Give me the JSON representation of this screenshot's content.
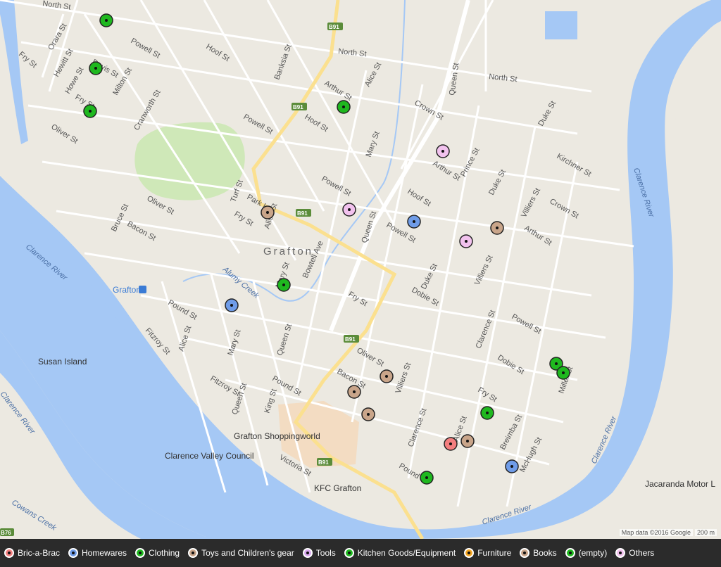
{
  "map": {
    "suburb": "Grafton",
    "attribution": "Map data ©2016 Google",
    "scale": "200 m",
    "colors": {
      "land": "#ece9e1",
      "water": "#a5c8f5",
      "park": "#cfe8b8",
      "road": "#ffffff",
      "highway": "#fbe08f",
      "mall": "#f3dcc2"
    }
  },
  "places": {
    "shopping": "Grafton Shoppingworld",
    "council": "Clarence Valley Council",
    "kfc": "KFC Grafton",
    "station": "Grafton",
    "motor": "Jacaranda Motor L",
    "island": "Susan Island"
  },
  "water_labels": {
    "clarence_1": "Clarence River",
    "clarence_2": "Clarence River",
    "clarence_3": "Clarence River",
    "clarence_4": "Clarence River",
    "clarence_5": "Clarence River",
    "alumy": "Alumy Creek",
    "cowans": "Cowans Creek"
  },
  "streets": {
    "north1": "North St",
    "north2": "North St",
    "north3": "North St",
    "powell1": "Powell St",
    "powell2": "Powell St",
    "powell3": "Powell St",
    "powell4": "Powell St",
    "powell5": "Powell St",
    "hoof1": "Hoof St",
    "hoof2": "Hoof St",
    "hoof3": "Hoof St",
    "oliver1": "Oliver St",
    "oliver2": "Oliver St",
    "oliver3": "Oliver St",
    "arthur1": "Arthur St",
    "arthur2": "Arthur St",
    "arthur3": "Arthur St",
    "fry1": "Fry St",
    "fry2": "Fry St",
    "fry3": "Fry St",
    "fry4": "Fry St",
    "pound1": "Pound St",
    "pound2": "Pound St",
    "pound3": "Pound St",
    "queen1": "Queen St",
    "queen2": "Queen St",
    "queen3": "Queen St",
    "queen4": "Queen St",
    "bacon1": "Bacon St",
    "bacon2": "Bacon St",
    "duke1": "Duke St",
    "duke2": "Duke St",
    "duke3": "Duke St",
    "mary1": "Mary St",
    "mary2": "Mary St",
    "villiers1": "Villiers St",
    "villiers2": "Villiers St",
    "villiers3": "Villiers St",
    "dobie1": "Dobie St",
    "dobie2": "Dobie St",
    "clarence1": "Clarence St",
    "clarence2": "Clarence St",
    "alice1": "Alice St",
    "alice2": "Alice St",
    "alice3": "Alice St",
    "crown1": "Crown St",
    "crown2": "Crown St",
    "orara": "Orara St",
    "hewitt": "Hewitt St",
    "howe": "Howe St",
    "milton": "Milton St",
    "cranworth": "Cranworth St",
    "banksia": "Banksia St",
    "turf": "Turf St",
    "parkl": "Park L",
    "bruce": "Bruce St",
    "fitzroy1": "Fitzroy St",
    "fitzroy2": "Fitzroy St",
    "king": "King St",
    "victoria": "Victoria St",
    "bowtell": "Bowtell Ave",
    "prince": "Prince St",
    "kirchner": "Kirchner St",
    "breimba": "Breimba St",
    "mcHugh": "McHugh St",
    "miller": "Miller St",
    "davis": "Davis St",
    "through": "Fry St",
    "mary3": "Mary St",
    "alice4": "Alice St",
    "b91a": "B91",
    "b91b": "B91",
    "b91c": "B91",
    "b91d": "B91",
    "b91e": "B91",
    "b76": "B76"
  },
  "legend": [
    {
      "label": "Bric-a-Brac",
      "color": "#f47f7f"
    },
    {
      "label": "Homewares",
      "color": "#6f9ce8"
    },
    {
      "label": "Clothing",
      "color": "#1fb81f"
    },
    {
      "label": "Toys and Children's gear",
      "color": "#c9a58a"
    },
    {
      "label": "Tools",
      "color": "#d9a8ee"
    },
    {
      "label": "Kitchen Goods/Equipment",
      "color": "#1fb81f"
    },
    {
      "label": "Furniture",
      "color": "#f5a623"
    },
    {
      "label": "Books",
      "color": "#c9a58a"
    },
    {
      "label": "(empty)",
      "color": "#1fb81f"
    },
    {
      "label": "Others",
      "color": "#f2c2ee"
    }
  ],
  "markers": [
    {
      "category": "(empty)",
      "color": "#1fb81f"
    },
    {
      "category": "(empty)",
      "color": "#1fb81f"
    },
    {
      "category": "(empty)",
      "color": "#1fb81f"
    },
    {
      "category": "(empty)",
      "color": "#1fb81f"
    },
    {
      "category": "Others",
      "color": "#f2c2ee"
    },
    {
      "category": "Books",
      "color": "#c9a58a"
    },
    {
      "category": "Others",
      "color": "#f2c2ee"
    },
    {
      "category": "Homewares",
      "color": "#6f9ce8"
    },
    {
      "category": "Books",
      "color": "#c9a58a"
    },
    {
      "category": "Others",
      "color": "#f2c2ee"
    },
    {
      "category": "(empty)",
      "color": "#1fb81f"
    },
    {
      "category": "Homewares",
      "color": "#6f9ce8"
    },
    {
      "category": "(empty)",
      "color": "#1fb81f"
    },
    {
      "category": "(empty)",
      "color": "#1fb81f"
    },
    {
      "category": "Books",
      "color": "#c9a58a"
    },
    {
      "category": "Books",
      "color": "#c9a58a"
    },
    {
      "category": "Books",
      "color": "#c9a58a"
    },
    {
      "category": "(empty)",
      "color": "#1fb81f"
    },
    {
      "category": "Bric-a-Brac",
      "color": "#f47f7f"
    },
    {
      "category": "Books",
      "color": "#c9a58a"
    },
    {
      "category": "Homewares",
      "color": "#6f9ce8"
    },
    {
      "category": "(empty)",
      "color": "#1fb81f"
    }
  ]
}
